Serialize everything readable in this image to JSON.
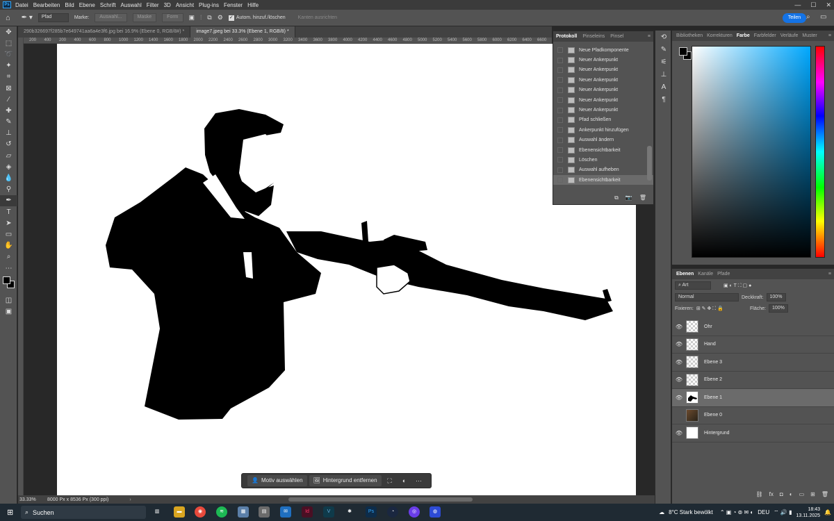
{
  "app": {
    "logo": "Ps",
    "menu": [
      "Datei",
      "Bearbeiten",
      "Bild",
      "Ebene",
      "Schrift",
      "Auswahl",
      "Filter",
      "3D",
      "Ansicht",
      "Plug-ins",
      "Fenster",
      "Hilfe"
    ]
  },
  "options_bar": {
    "mode": "Pfad",
    "marke_label": "Marke:",
    "auswahl_btn": "Auswahl...",
    "maske_btn": "Maske",
    "form_btn": "Form",
    "auto_add_label": "Autom. hinzuf./löschen",
    "align_edges_label": "Kanten ausrichten",
    "share_label": "Teilen"
  },
  "tabs": [
    {
      "label": "290b326697f285b7e649741aa6a4e3f6.jpg bei 16.9% (Ebene 0, RGB/8#) *"
    },
    {
      "label": "image7.jpeg bei 33.3% (Ebene 1, RGB/8) *"
    }
  ],
  "ruler_ticks": [
    "200",
    "400",
    "200",
    "400",
    "600",
    "800",
    "1000",
    "1200",
    "1400",
    "1600",
    "1800",
    "2000",
    "2200",
    "2400",
    "2600",
    "2800",
    "3000",
    "3200",
    "3400",
    "3600",
    "3800",
    "4000",
    "4200",
    "4400",
    "4600",
    "4800",
    "5000",
    "5200",
    "5400",
    "5600",
    "5800",
    "6000",
    "6200",
    "6400",
    "6600",
    "6800",
    "7000",
    "7200",
    "7400"
  ],
  "context_bar": {
    "select_subject": "Motiv auswählen",
    "remove_background": "Hintergrund entfernen"
  },
  "status": {
    "zoom": "33.33%",
    "doc_info": "8000 Px x 8536 Px (300 ppi)"
  },
  "history_panel": {
    "tabs": [
      "Protokoll",
      "Pinseleins",
      "Pinsel"
    ],
    "items": [
      "Neue Pfadkomponente",
      "Neuer Ankerpunkt",
      "Neuer Ankerpunkt",
      "Neuer Ankerpunkt",
      "Neuer Ankerpunkt",
      "Neuer Ankerpunkt",
      "Neuer Ankerpunkt",
      "Pfad schließen",
      "Ankerpunkt hinzufügen",
      "Auswahl ändern",
      "Ebenensichtbarkeit",
      "Löschen",
      "Auswahl aufheben",
      "Ebenensichtbarkeit"
    ],
    "selected_index": 13
  },
  "color_panel": {
    "tabs": [
      "Bibliotheken",
      "Korrekturen",
      "Farbe",
      "Farbfelder",
      "Verläufe",
      "Muster"
    ],
    "active_tab": "Farbe",
    "foreground": "#000000",
    "background": "#000000"
  },
  "layers_panel": {
    "tabs": [
      "Ebenen",
      "Kanäle",
      "Pfade"
    ],
    "filter": "Art",
    "blend_mode": "Normal",
    "opacity_label": "Deckkraft:",
    "opacity": "100%",
    "fill_label": "Fläche:",
    "fill": "100%",
    "lock_label": "Fixieren:",
    "layers": [
      {
        "name": "Ohr",
        "visible": true,
        "thumb": "transparent"
      },
      {
        "name": "Hand",
        "visible": true,
        "thumb": "transparent"
      },
      {
        "name": "Ebene 3",
        "visible": true,
        "thumb": "transparent"
      },
      {
        "name": "Ebene 2",
        "visible": true,
        "thumb": "transparent"
      },
      {
        "name": "Ebene 1",
        "visible": true,
        "thumb": "silhouette",
        "selected": true
      },
      {
        "name": "Ebene 0",
        "visible": false,
        "thumb": "photo"
      },
      {
        "name": "Hintergrund",
        "visible": true,
        "thumb": "white"
      }
    ]
  },
  "taskbar": {
    "search_label": "Suchen",
    "weather": "8°C  Stark bewölkt",
    "lang": "DEU",
    "time": "18:43",
    "date": "13.11.2025"
  }
}
